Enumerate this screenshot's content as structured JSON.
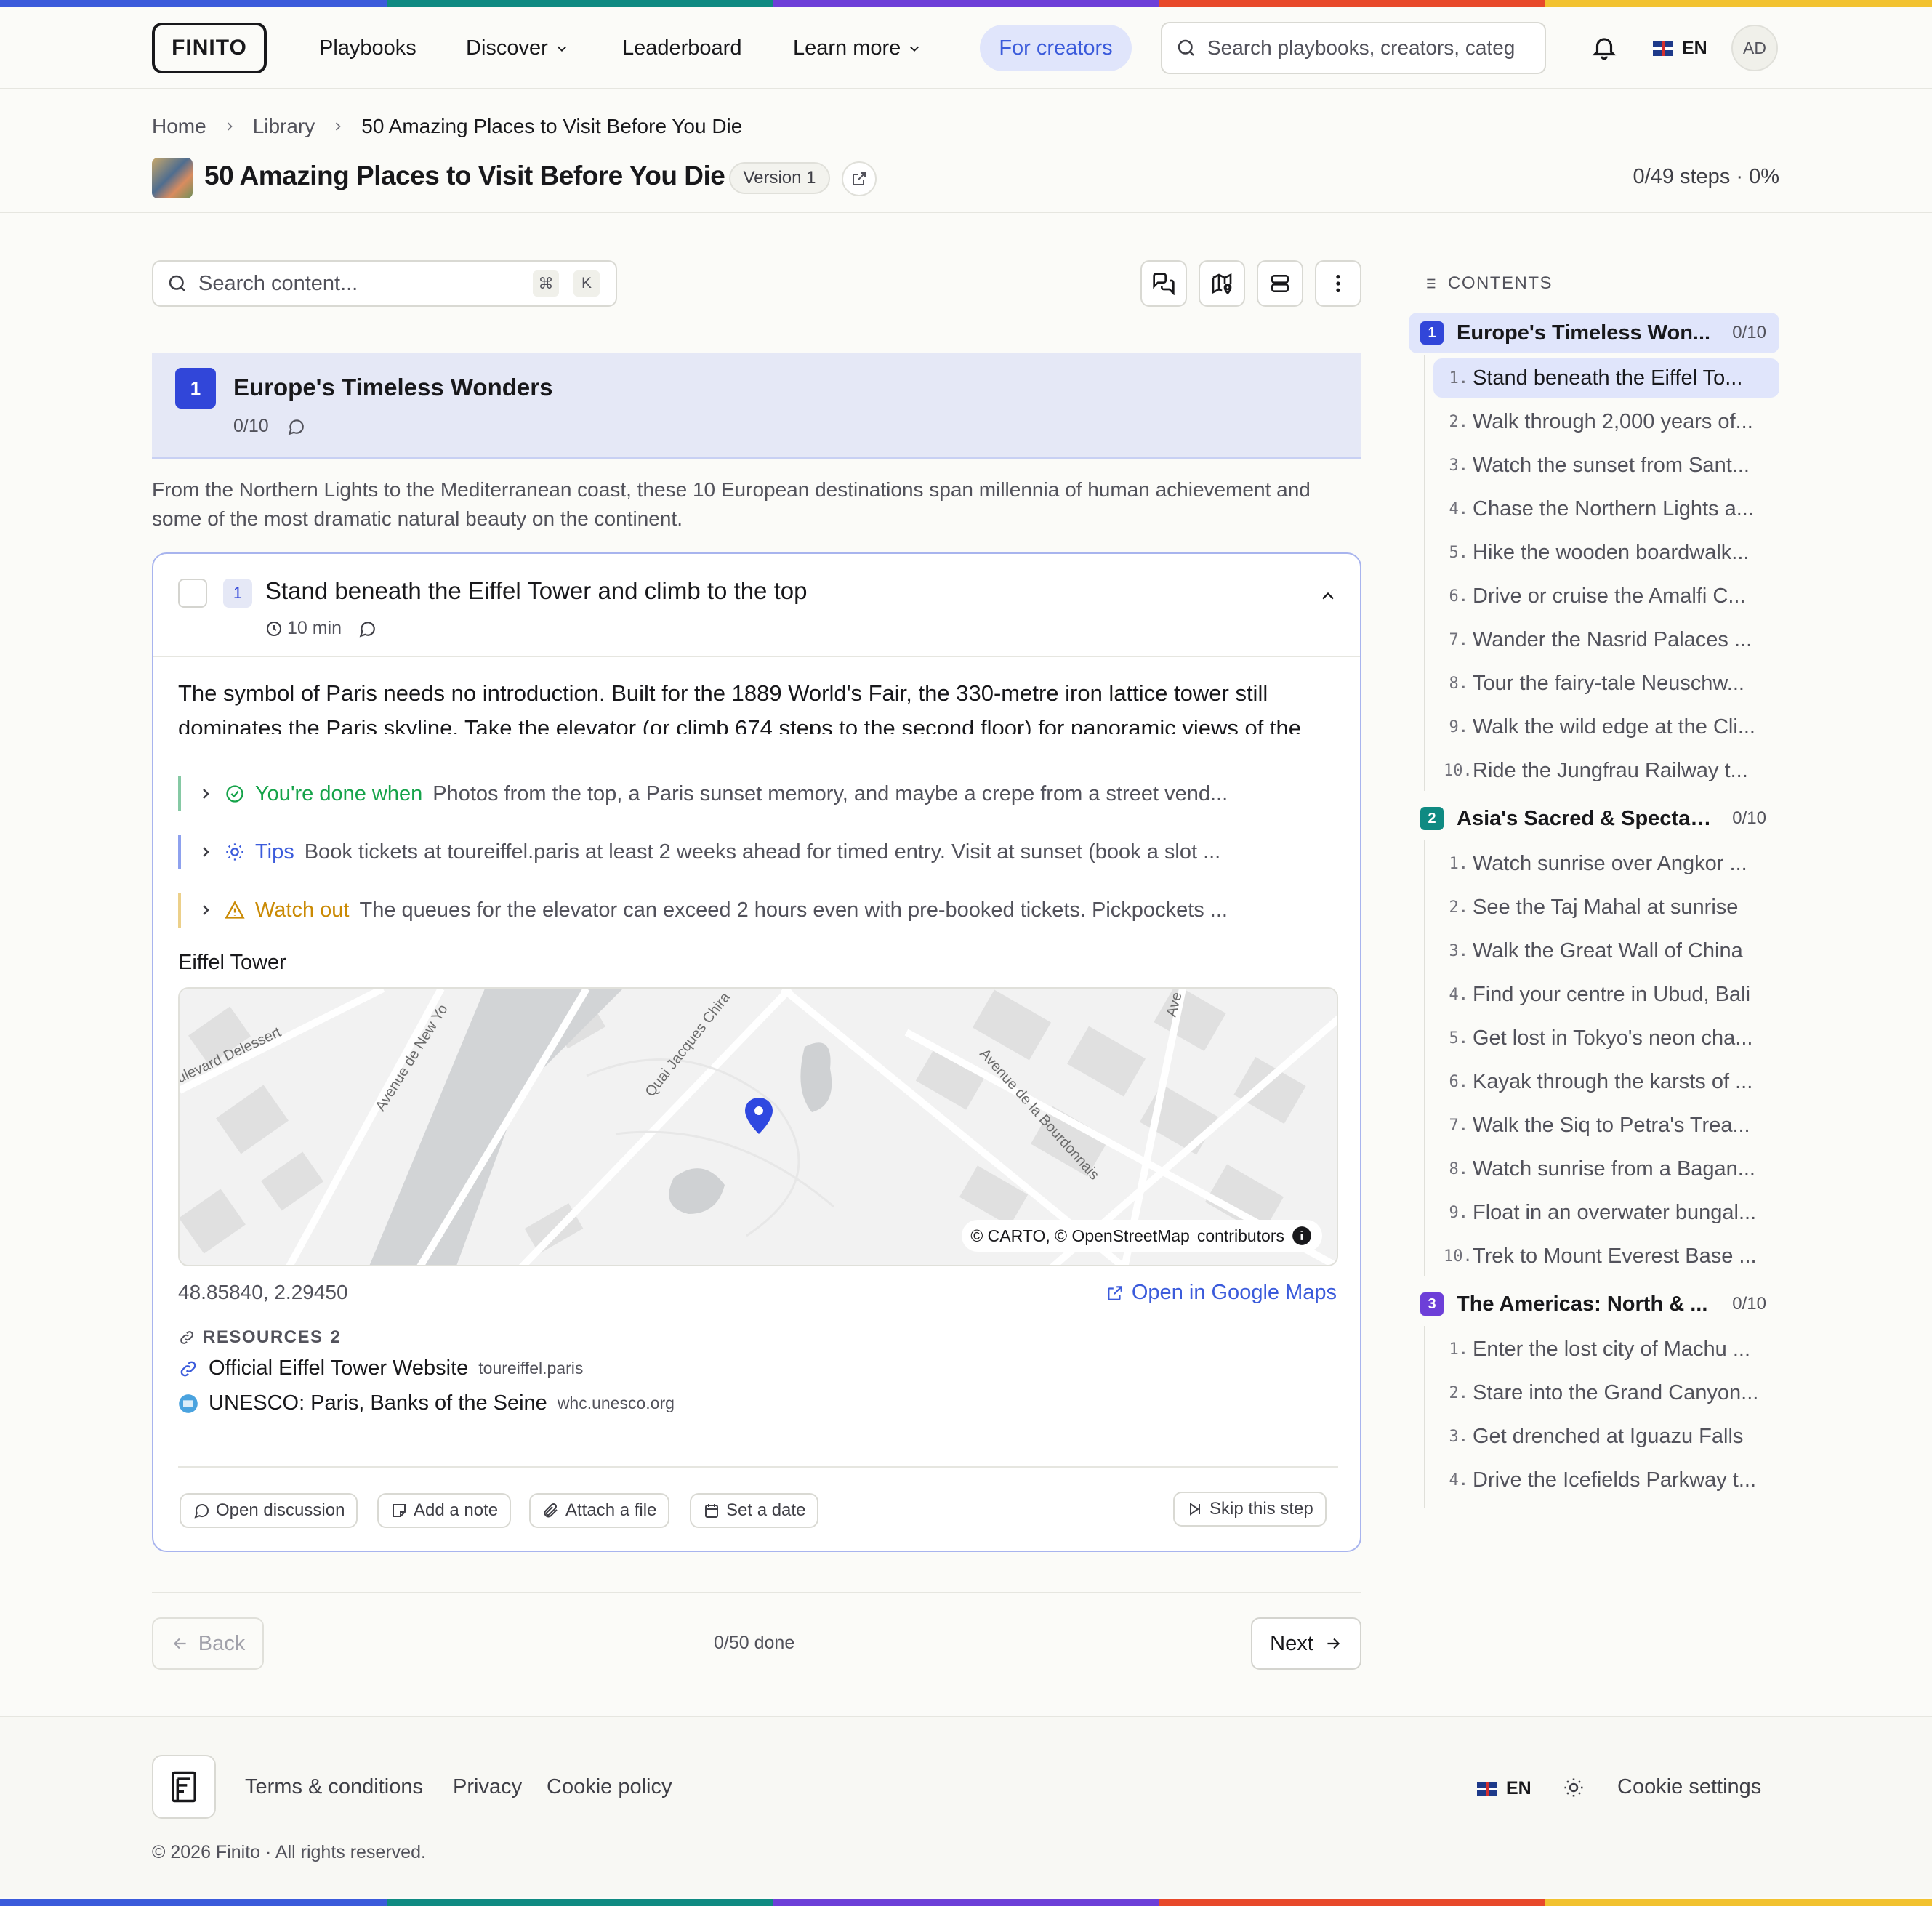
{
  "header": {
    "logo": "FINITO",
    "nav": {
      "playbooks": "Playbooks",
      "discover": "Discover",
      "leaderboard": "Leaderboard",
      "learn_more": "Learn more",
      "for_creators": "For creators"
    },
    "search_placeholder": "Search playbooks, creators, categ",
    "language": "EN",
    "avatar": "AD"
  },
  "breadcrumb": {
    "home": "Home",
    "library": "Library",
    "current": "50 Amazing Places to Visit Before You Die"
  },
  "playbook": {
    "title": "50 Amazing Places to Visit Before You Die",
    "version": "Version 1",
    "progress": "0/49 steps · 0%"
  },
  "content_search": {
    "placeholder": "Search content...",
    "kbd1": "⌘",
    "kbd2": "K"
  },
  "section": {
    "number": "1",
    "title": "Europe's Timeless Wonders",
    "count": "0/10",
    "description": "From the Northern Lights to the Mediterranean coast, these 10 European destinations span millennia of human achievement and some of the most dramatic natural beauty on the continent."
  },
  "step": {
    "number": "1",
    "title": "Stand beneath the Eiffel Tower and climb to the top",
    "duration": "10 min",
    "body": "The symbol of Paris needs no introduction. Built for the 1889 World's Fair, the 330-metre iron lattice tower still dominates the Paris skyline. Take the elevator (or climb 674 steps to the second floor) for panoramic views of the Seine, Sacré-Cœur, and the entire City of Light. The nightly sparkle show — 20,000 bulbs flashing for 5",
    "callouts": {
      "done": {
        "label": "You're done when",
        "text": "Photos from the top, a Paris sunset memory, and maybe a crepe from a street vend..."
      },
      "tips": {
        "label": "Tips",
        "text": "Book tickets at toureiffel.paris at least 2 weeks ahead for timed entry. Visit at sunset (book a slot ..."
      },
      "watch": {
        "label": "Watch out",
        "text": "The queues for the elevator can exceed 2 hours even with pre-booked tickets. Pickpockets ..."
      }
    },
    "map": {
      "label": "Eiffel Tower",
      "attribution_carto": "© CARTO, © OpenStreetMap",
      "attribution_contrib": "contributors",
      "streets": [
        "Avenue de New Yo",
        "Quai Jacques Chira",
        "Avenue de la Bourdonnais",
        "ulevard Delessert",
        "Ave"
      ],
      "coords": "48.85840, 2.29450",
      "open_link": "Open in Google Maps"
    },
    "resources": {
      "label": "RESOURCES",
      "count": "2",
      "items": [
        {
          "name": "Official Eiffel Tower Website",
          "domain": "toureiffel.paris"
        },
        {
          "name": "UNESCO: Paris, Banks of the Seine",
          "domain": "whc.unesco.org"
        }
      ]
    },
    "actions": {
      "discussion": "Open discussion",
      "note": "Add a note",
      "attach": "Attach a file",
      "date": "Set a date",
      "skip": "Skip this step"
    }
  },
  "pager": {
    "back": "Back",
    "done": "0/50 done",
    "next": "Next"
  },
  "toc": {
    "heading": "CONTENTS",
    "sections": [
      {
        "number": "1",
        "title": "Europe's Timeless Won...",
        "count": "0/10",
        "color": "#3146d9",
        "items": [
          "Stand beneath the Eiffel To...",
          "Walk through 2,000 years of...",
          "Watch the sunset from Sant...",
          "Chase the Northern Lights a...",
          "Hike the wooden boardwalk...",
          "Drive or cruise the Amalfi C...",
          "Wander the Nasrid Palaces ...",
          "Tour the fairy-tale Neuschw...",
          "Walk the wild edge at the Cli...",
          "Ride the Jungfrau Railway t..."
        ]
      },
      {
        "number": "2",
        "title": "Asia's Sacred & Spectac...",
        "count": "0/10",
        "color": "#0f8a82",
        "items": [
          "Watch sunrise over Angkor ...",
          "See the Taj Mahal at sunrise",
          "Walk the Great Wall of China",
          "Find your centre in Ubud, Bali",
          "Get lost in Tokyo's neon cha...",
          "Kayak through the karsts of ...",
          "Walk the Siq to Petra's Trea...",
          "Watch sunrise from a Bagan...",
          "Float in an overwater bungal...",
          "Trek to Mount Everest Base ..."
        ]
      },
      {
        "number": "3",
        "title": "The Americas: North & ...",
        "count": "0/10",
        "color": "#6d3fd8",
        "items": [
          "Enter the lost city of Machu ...",
          "Stare into the Grand Canyon...",
          "Get drenched at Iguazu Falls",
          "Drive the Icefields Parkway t..."
        ]
      }
    ]
  },
  "footer": {
    "terms": "Terms & conditions",
    "privacy": "Privacy",
    "cookie_policy": "Cookie policy",
    "language": "EN",
    "cookie_settings": "Cookie settings",
    "copyright": "© 2026 Finito · All rights reserved."
  },
  "colors": {
    "accent": "#3b5bdb",
    "success": "#16a34a",
    "warning": "#ca8a04",
    "rainbow": [
      "#3b5bdb",
      "#0f8a82",
      "#6d3fd8",
      "#e8492a",
      "#f2c230"
    ]
  }
}
